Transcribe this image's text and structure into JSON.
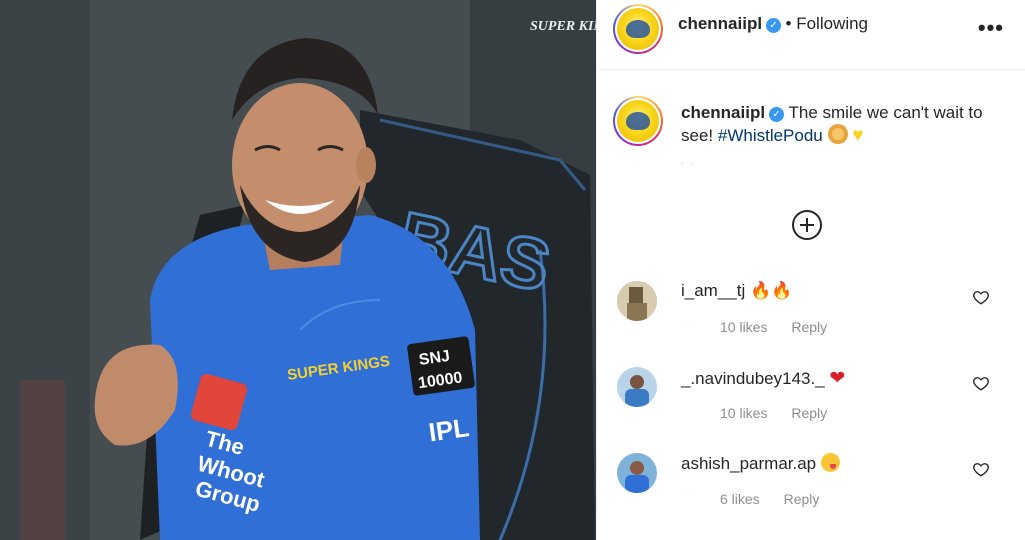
{
  "post": {
    "author": "chennaiipl",
    "follow_state": "• Following",
    "more_label": "•••",
    "caption_text": "The smile we can't wait to see!",
    "caption_hashtag": "#WhistlePodu",
    "caption_emojis": [
      "lion-face-emoji",
      "yellow-heart-emoji"
    ],
    "load_more_icon": "plus-circle-icon"
  },
  "photo": {
    "watermark": "SUPER KINGS",
    "bag_text": "BAS",
    "jersey_logo": "SUPER KINGS",
    "sleeve_badge_top": "SNJ",
    "sleeve_badge_bottom": "10000",
    "sleeve_ipl": "IPL",
    "sponsor_lines": [
      "The",
      "Whoot",
      "Group"
    ]
  },
  "comments": [
    {
      "username": "i_am__tj",
      "emoji": "🔥🔥",
      "likes": "10 likes",
      "reply": "Reply"
    },
    {
      "username": "_.navindubey143._",
      "emoji": "❤",
      "likes": "10 likes",
      "reply": "Reply"
    },
    {
      "username": "ashish_parmar.ap",
      "emoji": "yum-emoji",
      "likes": "6 likes",
      "reply": "Reply"
    }
  ],
  "colors": {
    "verified": "#3897f0",
    "hashtag": "#00376b",
    "jersey": "#2f6fd6",
    "meta": "#8e8e8e"
  }
}
